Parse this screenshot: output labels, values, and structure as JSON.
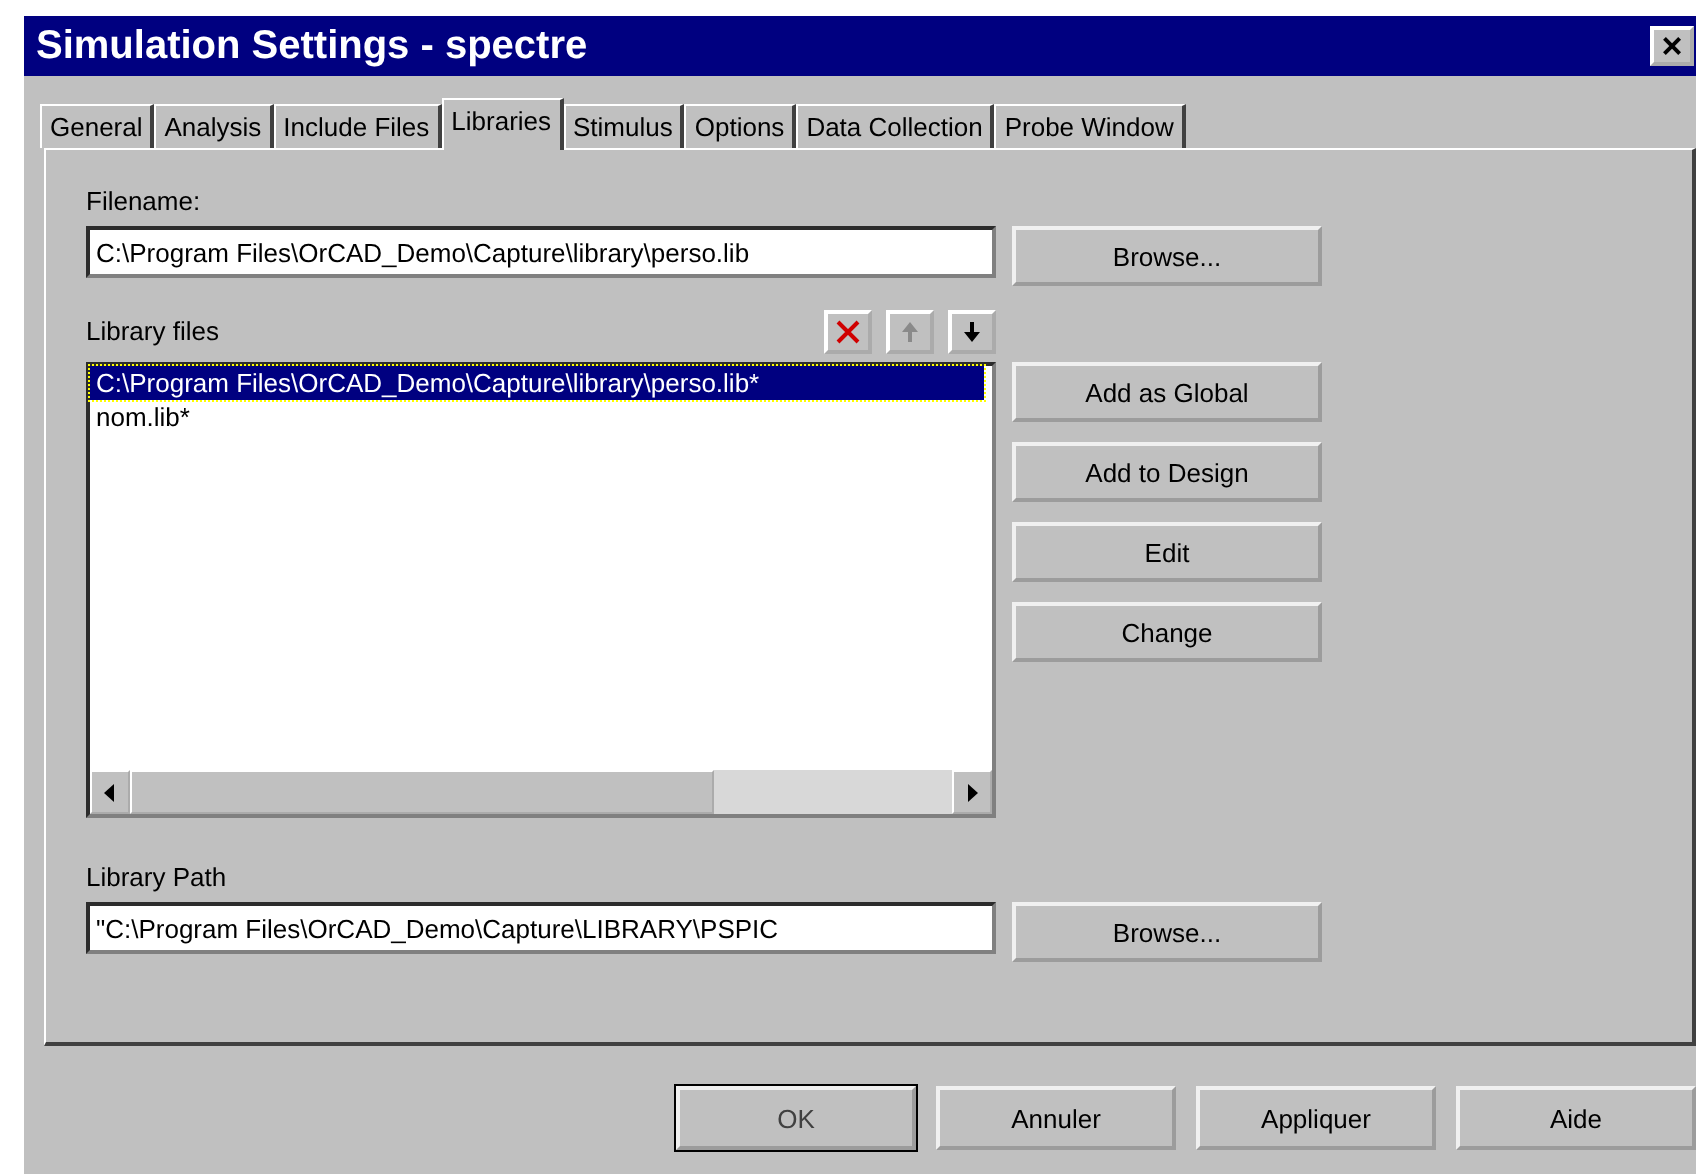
{
  "window": {
    "title": "Simulation Settings - spectre",
    "close": "×"
  },
  "tabs": [
    {
      "label": "General",
      "selected": false
    },
    {
      "label": "Analysis",
      "selected": false
    },
    {
      "label": "Include Files",
      "selected": false
    },
    {
      "label": "Libraries",
      "selected": true
    },
    {
      "label": "Stimulus",
      "selected": false
    },
    {
      "label": "Options",
      "selected": false
    },
    {
      "label": "Data Collection",
      "selected": false
    },
    {
      "label": "Probe Window",
      "selected": false
    }
  ],
  "filename": {
    "label": "Filename:",
    "value": "C:\\Program Files\\OrCAD_Demo\\Capture\\library\\perso.lib",
    "button": "Browse..."
  },
  "library_files": {
    "label": "Library files",
    "tools": [
      {
        "kind": "delete",
        "disabled": false
      },
      {
        "kind": "up",
        "disabled": true
      },
      {
        "kind": "down",
        "disabled": false
      }
    ],
    "items": [
      {
        "text": "C:\\Program Files\\OrCAD_Demo\\Capture\\library\\perso.lib*",
        "selected": true
      },
      {
        "text": "nom.lib*",
        "selected": false
      }
    ],
    "buttons": [
      "Add as Global",
      "Add to Design",
      "Edit",
      "Change"
    ]
  },
  "library_path": {
    "label": "Library Path",
    "value": "\"C:\\Program Files\\OrCAD_Demo\\Capture\\LIBRARY\\PSPIC",
    "button": "Browse..."
  },
  "buttons": [
    {
      "label": "OK",
      "default": true
    },
    {
      "label": "Annuler",
      "default": false
    },
    {
      "label": "Appliquer",
      "default": false
    },
    {
      "label": "Aide",
      "default": false
    }
  ]
}
